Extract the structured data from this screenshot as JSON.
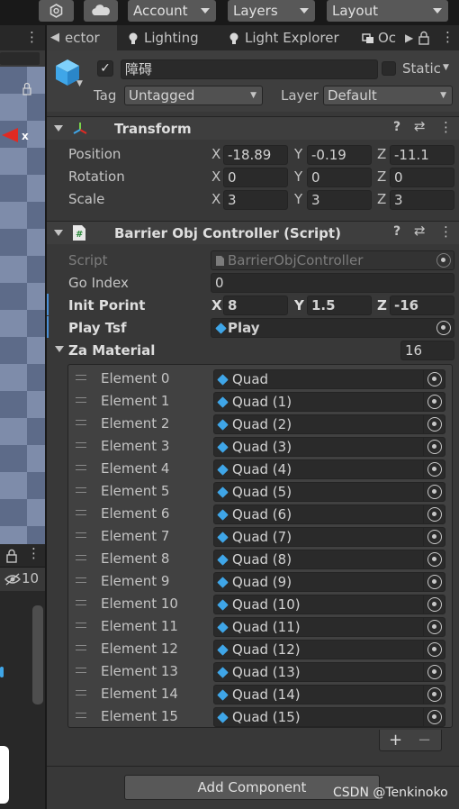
{
  "toolbar": {
    "account_label": "Account",
    "layers_label": "Layers",
    "layout_label": "Layout"
  },
  "tabs": [
    {
      "label": "ector",
      "icon": "inspector-icon"
    },
    {
      "label": "Lighting",
      "icon": "bulb-icon"
    },
    {
      "label": "Light Explorer",
      "icon": "bulb-icon"
    },
    {
      "label": "Oc",
      "icon": "occlusion-icon"
    }
  ],
  "scene": {
    "axis_label": "x",
    "visibility_count": "10"
  },
  "gameobject": {
    "active": true,
    "name": "障碍",
    "static_label": "Static",
    "tag_label": "Tag",
    "tag_value": "Untagged",
    "layer_label": "Layer",
    "layer_value": "Default"
  },
  "transform": {
    "title": "Transform",
    "rows": [
      {
        "label": "Position",
        "x": "-18.89",
        "y": "-0.19",
        "z": "-11.1"
      },
      {
        "label": "Rotation",
        "x": "0",
        "y": "0",
        "z": "0"
      },
      {
        "label": "Scale",
        "x": "3",
        "y": "3",
        "z": "3"
      }
    ],
    "axis": {
      "x": "X",
      "y": "Y",
      "z": "Z"
    }
  },
  "script_component": {
    "title": "Barrier Obj Controller (Script)",
    "script_label": "Script",
    "script_value": "BarrierObjController",
    "go_index_label": "Go Index",
    "go_index_value": "0",
    "init_label": "Init Porint",
    "init": {
      "x": "8",
      "y": "1.5",
      "z": "-16"
    },
    "play_label": "Play Tsf",
    "play_value": "Play",
    "za_label": "Za Material",
    "za_count": "16",
    "elements": [
      {
        "label": "Element 0",
        "value": "Quad"
      },
      {
        "label": "Element 1",
        "value": "Quad (1)"
      },
      {
        "label": "Element 2",
        "value": "Quad (2)"
      },
      {
        "label": "Element 3",
        "value": "Quad (3)"
      },
      {
        "label": "Element 4",
        "value": "Quad (4)"
      },
      {
        "label": "Element 5",
        "value": "Quad (5)"
      },
      {
        "label": "Element 6",
        "value": "Quad (6)"
      },
      {
        "label": "Element 7",
        "value": "Quad (7)"
      },
      {
        "label": "Element 8",
        "value": "Quad (8)"
      },
      {
        "label": "Element 9",
        "value": "Quad (9)"
      },
      {
        "label": "Element 10",
        "value": "Quad (10)"
      },
      {
        "label": "Element 11",
        "value": "Quad (11)"
      },
      {
        "label": "Element 12",
        "value": "Quad (12)"
      },
      {
        "label": "Element 13",
        "value": "Quad (13)"
      },
      {
        "label": "Element 14",
        "value": "Quad (14)"
      },
      {
        "label": "Element 15",
        "value": "Quad (15)"
      }
    ],
    "plus_label": "+",
    "minus_label": "−"
  },
  "add_component_label": "Add Component",
  "watermark": "CSDN @Tenkinoko",
  "colors": {
    "accent_blue": "#4a8fd6",
    "cube_blue": "#3fa6e8",
    "gizmo_red": "#e02a22"
  }
}
